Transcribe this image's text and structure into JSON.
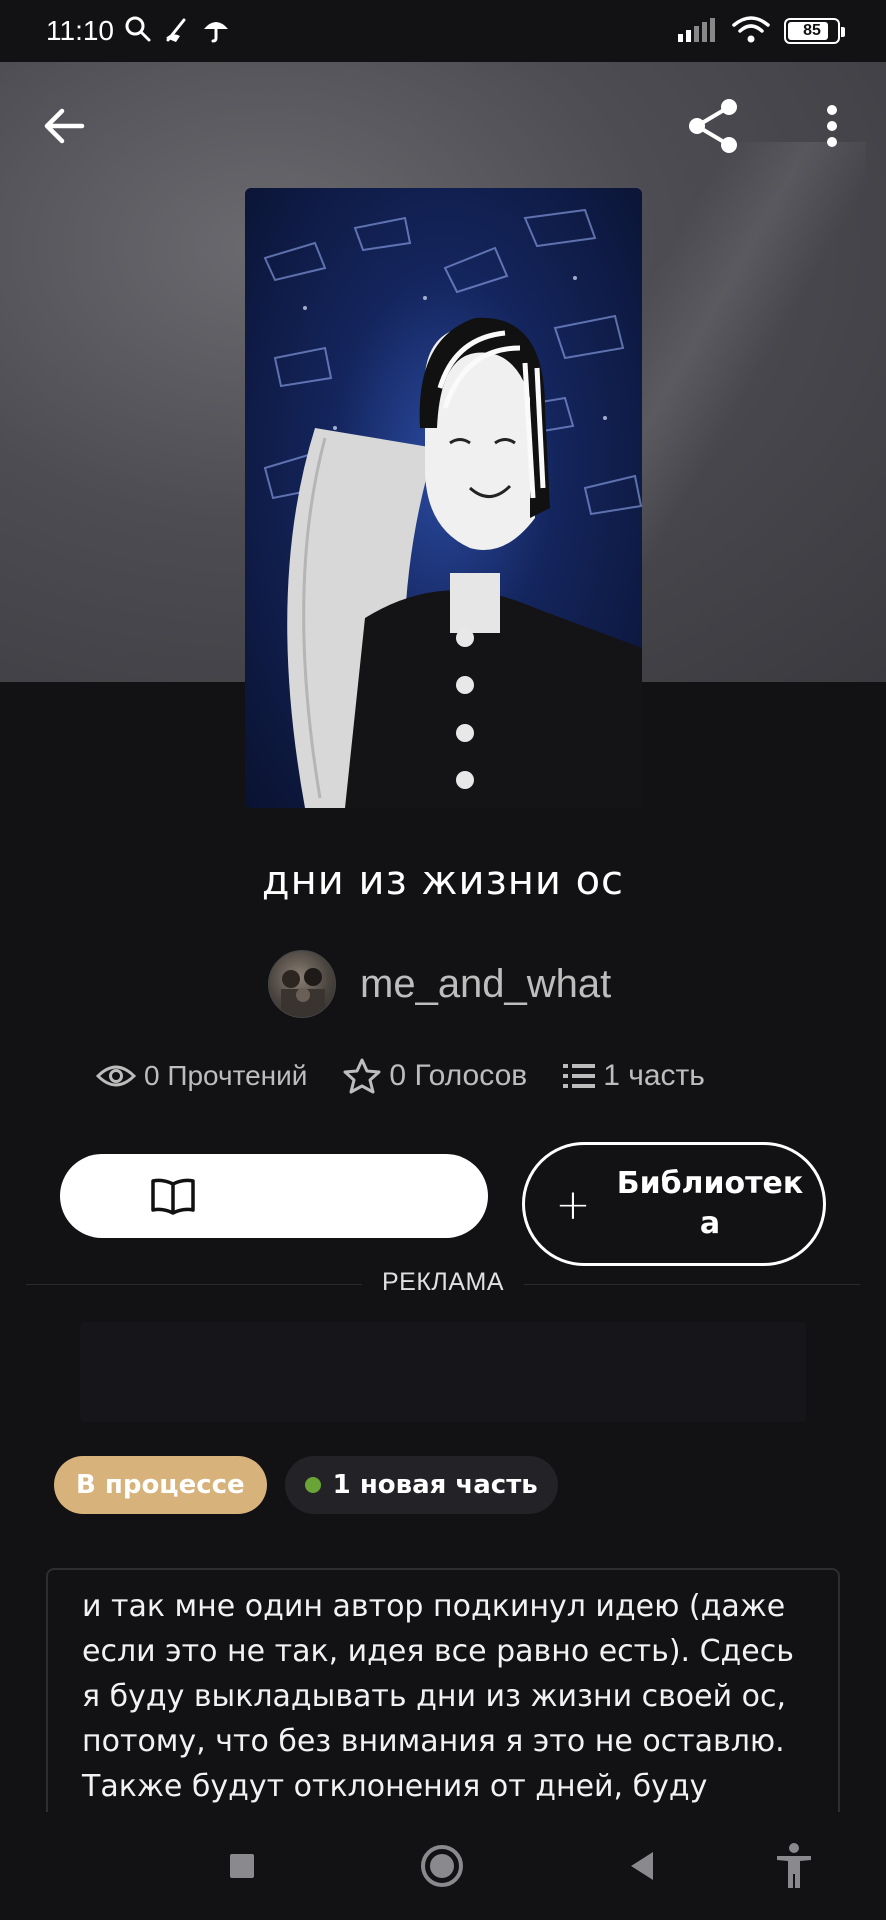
{
  "status_bar": {
    "time": "11:10",
    "battery": "85",
    "battery_level": 0.85,
    "left_icons": [
      "search-icon",
      "broom-icon",
      "umbrella-icon"
    ],
    "right_icons": [
      "signal-icon",
      "wifi-icon",
      "battery-icon"
    ]
  },
  "header": {
    "back_icon": "arrow-left-icon",
    "share_icon": "share-icon",
    "more_icon": "more-vertical-icon"
  },
  "story": {
    "title": "дни из жизни ос",
    "author": "me_and_what",
    "reads": "0 Прочтений",
    "votes": "0 Голосов",
    "parts": "1 часть"
  },
  "actions": {
    "read_icon": "open-book-icon",
    "library_label": "Библиотека",
    "library_icon": "plus-icon"
  },
  "ad": {
    "label": "РЕКЛАМА"
  },
  "tags": {
    "status": "В процессе",
    "new_parts": "1 новая часть"
  },
  "description": "и так мне один автор подкинул идею (даже если это не так, идея все равно есть). Сдесь я буду выкладывать дни из жизни своей ос, потому, что без внимания я это не оставлю. Также будут отклонения от дней, буду писать",
  "nav_bar": {
    "icons": [
      "recents-square-icon",
      "home-circle-icon",
      "back-triangle-icon",
      "accessibility-icon"
    ]
  },
  "colors": {
    "background": "#121114",
    "status_tag": "#d7b27a",
    "new_dot": "#6aa336",
    "muted_text": "#bdbdbd"
  }
}
